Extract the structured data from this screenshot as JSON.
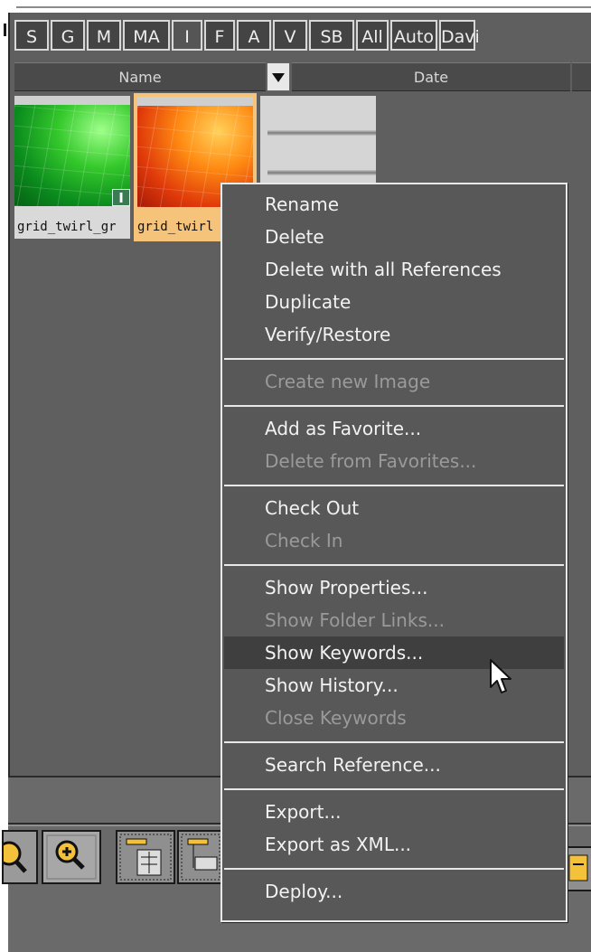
{
  "tabs": [
    "S",
    "G",
    "M",
    "MA",
    "I",
    "F",
    "A",
    "V",
    "SB",
    "All",
    "Auto",
    "Davi"
  ],
  "active_tab_index": 4,
  "columns": {
    "name": "Name",
    "date": "Date"
  },
  "thumbnails": [
    {
      "label": "grid_twirl_gr",
      "color": "green",
      "badge": "I",
      "selected": false
    },
    {
      "label": "grid_twirl",
      "color": "orange",
      "selected": true
    },
    {
      "label": "",
      "color": "grey",
      "selected": false
    }
  ],
  "context_menu": {
    "groups": [
      [
        {
          "label": "Rename",
          "enabled": true
        },
        {
          "label": "Delete",
          "enabled": true
        },
        {
          "label": "Delete with all References",
          "enabled": true
        },
        {
          "label": "Duplicate",
          "enabled": true
        },
        {
          "label": "Verify/Restore",
          "enabled": true
        }
      ],
      [
        {
          "label": "Create new Image",
          "enabled": false
        }
      ],
      [
        {
          "label": "Add as Favorite...",
          "enabled": true
        },
        {
          "label": "Delete from Favorites...",
          "enabled": false
        }
      ],
      [
        {
          "label": "Check Out",
          "enabled": true
        },
        {
          "label": "Check In",
          "enabled": false
        }
      ],
      [
        {
          "label": "Show Properties...",
          "enabled": true
        },
        {
          "label": "Show Folder Links...",
          "enabled": false
        },
        {
          "label": "Show Keywords...",
          "enabled": true,
          "hovered": true
        },
        {
          "label": "Show History...",
          "enabled": true
        },
        {
          "label": "Close Keywords",
          "enabled": false
        }
      ],
      [
        {
          "label": "Search Reference...",
          "enabled": true
        }
      ],
      [
        {
          "label": "Export...",
          "enabled": true
        },
        {
          "label": "Export as XML...",
          "enabled": true
        }
      ],
      [
        {
          "label": "Deploy...",
          "enabled": true
        }
      ]
    ]
  },
  "toolbar_icons": [
    "zoom-out-icon",
    "zoom-in-icon",
    "tree-view-icon",
    "tree-view-alt-icon",
    "export-icon"
  ],
  "colors": {
    "panel": "#5f5f5f",
    "menu": "#585858",
    "selection": "#f5c47a",
    "menu_border": "#e8e8e8",
    "disabled_text": "#9a9a9a"
  }
}
